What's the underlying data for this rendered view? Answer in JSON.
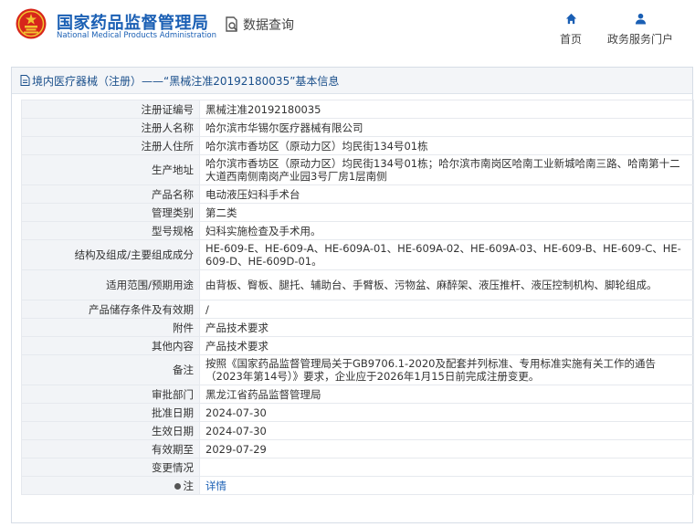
{
  "header": {
    "site_title_cn": "国家药品监督管理局",
    "site_title_en": "National Medical Products Administration",
    "query_label": "数据查询",
    "nav": [
      {
        "label": "首页",
        "icon": "home-icon"
      },
      {
        "label": "政务服务门户",
        "icon": "user-icon"
      }
    ]
  },
  "panel": {
    "title": "境内医疗器械（注册）——“黑械注准20192180035”基本信息"
  },
  "record": {
    "rows": [
      {
        "label": "注册证编号",
        "value": "黑械注准20192180035"
      },
      {
        "label": "注册人名称",
        "value": "哈尔滨市华锡尔医疗器械有限公司"
      },
      {
        "label": "注册人住所",
        "value": "哈尔滨市香坊区（原动力区）均民街134号01栋"
      },
      {
        "label": "生产地址",
        "value": "哈尔滨市香坊区（原动力区）均民街134号01栋；哈尔滨市南岗区哈南工业新城哈南三路、哈南第十二大道西南侧南岗产业园3号厂房1层南侧"
      },
      {
        "label": "产品名称",
        "value": "电动液压妇科手术台"
      },
      {
        "label": "管理类别",
        "value": "第二类"
      },
      {
        "label": "型号规格",
        "value": "妇科实施检查及手术用。"
      },
      {
        "label": "结构及组成/主要组成成分",
        "value": "HE-609-E、HE-609-A、HE-609A-01、HE-609A-02、HE-609A-03、HE-609-B、HE-609-C、HE-609-D、HE-609D-01。"
      },
      {
        "label": "适用范围/预期用途",
        "value": "由背板、臀板、腿托、辅助台、手臂板、污物盆、麻醉架、液压推杆、液压控制机构、脚轮组成。"
      },
      {
        "label": "产品储存条件及有效期",
        "value": "/"
      },
      {
        "label": "附件",
        "value": "产品技术要求"
      },
      {
        "label": "其他内容",
        "value": "产品技术要求"
      },
      {
        "label": "备注",
        "value": "按照《国家药品监督管理局关于GB9706.1-2020及配套并列标准、专用标准实施有关工作的通告（2023年第14号）》要求，企业应于2026年1月15日前完成注册变更。"
      },
      {
        "label": "审批部门",
        "value": "黑龙江省药品监督管理局"
      },
      {
        "label": "批准日期",
        "value": "2024-07-30"
      },
      {
        "label": "生效日期",
        "value": "2024-07-30"
      },
      {
        "label": "有效期至",
        "value": "2029-07-29"
      },
      {
        "label": "变更情况",
        "value": ""
      }
    ],
    "note_label": "注",
    "note_link": "详情"
  },
  "colors": {
    "brand_blue": "#1a5fb4",
    "logo_red": "#d7261b",
    "logo_gold": "#f2c230",
    "label_bg": "#f2f4f7"
  }
}
